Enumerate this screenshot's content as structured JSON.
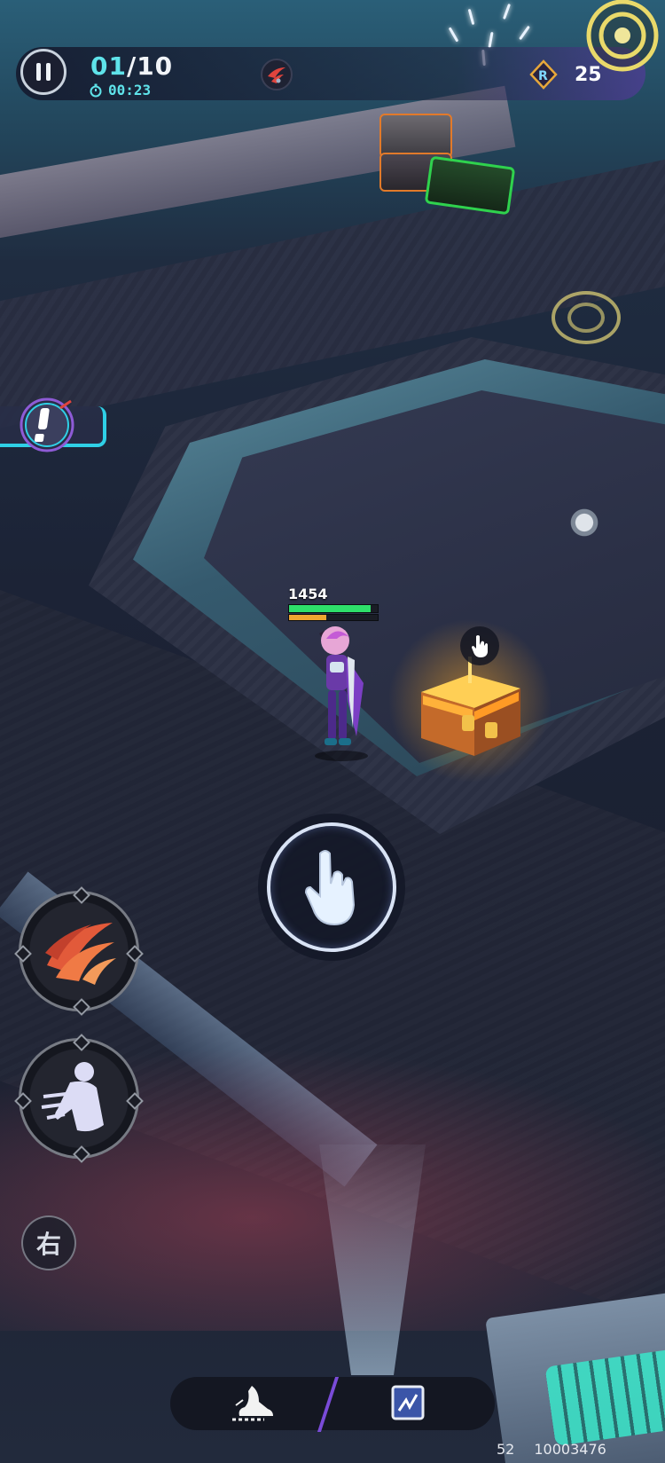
{
  "hud": {
    "wave_current": "01",
    "wave_total": "/10",
    "timer": "00:23",
    "currency_value": "25"
  },
  "player": {
    "hp_value": "1454",
    "hp_fraction": 0.92,
    "energy_fraction": 0.42
  },
  "controls": {
    "swap_label": "右"
  },
  "footer": {
    "fps": "52",
    "uid": "10003476"
  },
  "colors": {
    "accent_cyan": "#5fe3ea",
    "hp_green": "#2ee06a",
    "energy_orange": "#f0a630",
    "chest_glow": "#ffae2a",
    "bottom_divider": "#7a4bd8"
  },
  "icons": {
    "pause": "pause-icon",
    "timer": "stopwatch-icon",
    "boss": "boss-claw-icon",
    "currency": "crystal-currency-icon",
    "target": "target-ring-icon",
    "mission": "exclamation-icon",
    "interact": "tap-hand-icon",
    "skill_1": "claw-slash-icon",
    "skill_2": "dash-figure-icon",
    "dash": "boot-icon",
    "card": "card-icon"
  }
}
